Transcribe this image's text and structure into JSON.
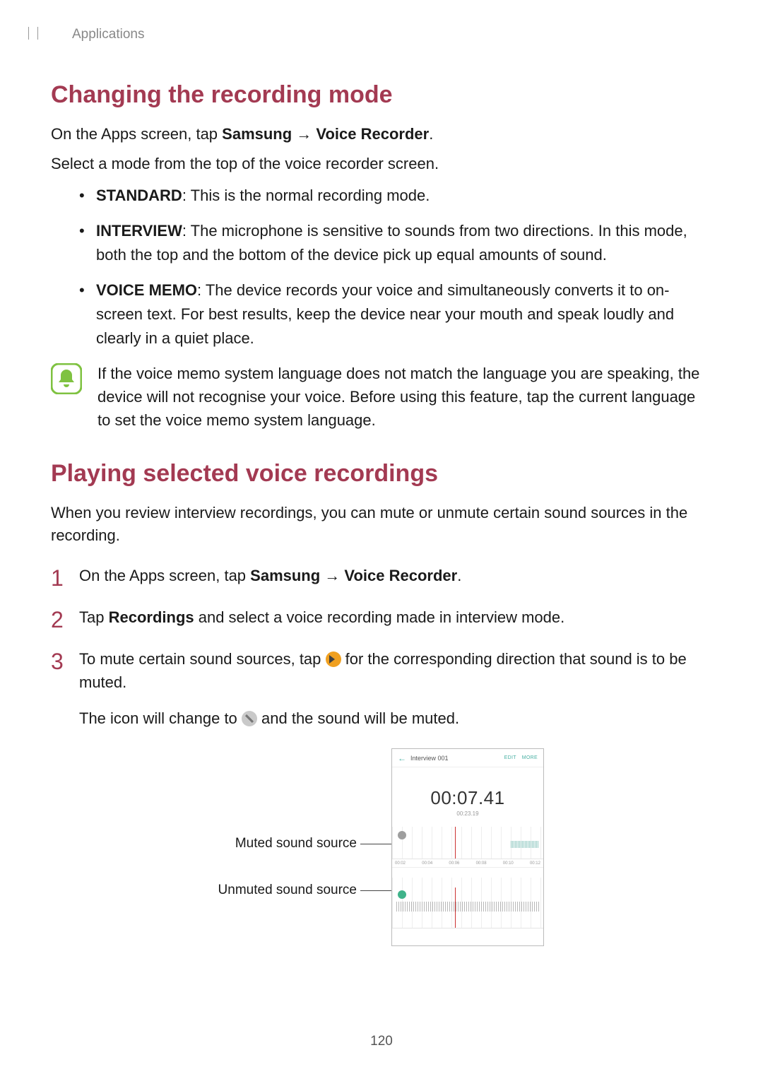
{
  "breadcrumb": "Applications",
  "section1": {
    "title": "Changing the recording mode",
    "intro_pre": "On the Apps screen, tap ",
    "intro_b1": "Samsung",
    "intro_arrow": " → ",
    "intro_b2": "Voice Recorder",
    "intro_post": ".",
    "line2": "Select a mode from the top of the voice recorder screen.",
    "bullets": [
      {
        "label": "STANDARD",
        "text": ": This is the normal recording mode."
      },
      {
        "label": "INTERVIEW",
        "text": ": The microphone is sensitive to sounds from two directions. In this mode, both the top and the bottom of the device pick up equal amounts of sound."
      },
      {
        "label": "VOICE MEMO",
        "text": ": The device records your voice and simultaneously converts it to on-screen text. For best results, keep the device near your mouth and speak loudly and clearly in a quiet place."
      }
    ],
    "note": "If the voice memo system language does not match the language you are speaking, the device will not recognise your voice. Before using this feature, tap the current language to set the voice memo system language."
  },
  "section2": {
    "title": "Playing selected voice recordings",
    "intro": "When you review interview recordings, you can mute or unmute certain sound sources in the recording.",
    "step1_pre": "On the Apps screen, tap ",
    "step1_b1": "Samsung",
    "step1_arrow": " → ",
    "step1_b2": "Voice Recorder",
    "step1_post": ".",
    "step2_pre": "Tap ",
    "step2_b": "Recordings",
    "step2_post": " and select a voice recording made in interview mode.",
    "step3_pre": "To mute certain sound sources, tap ",
    "step3_post": " for the corresponding direction that sound is to be muted.",
    "step3_sub_pre": "The icon will change to ",
    "step3_sub_post": " and the sound will be muted."
  },
  "mockup": {
    "callout_muted": "Muted sound source",
    "callout_unmuted": "Unmuted sound source",
    "header_title": "Interview 001",
    "edit": "EDIT",
    "more": "MORE",
    "time_big": "00:07.41",
    "time_small": "00:23.19",
    "ticks": [
      "00:02",
      "00:04",
      "00:06",
      "00:08",
      "00:10",
      "00:12"
    ]
  },
  "page_number": "120"
}
